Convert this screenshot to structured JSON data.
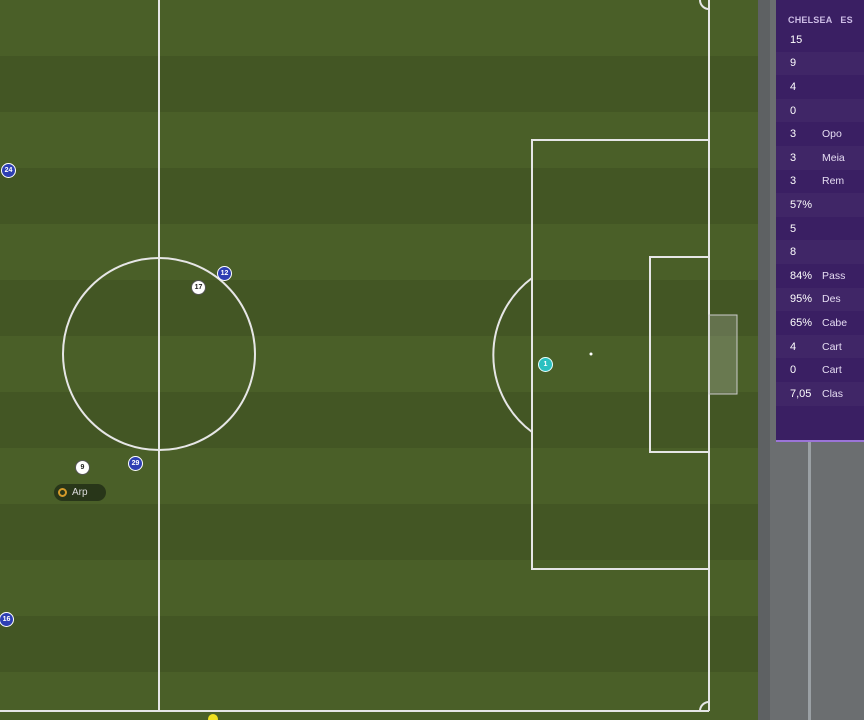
{
  "pitch": {
    "players": [
      {
        "number": "24",
        "team": "blue"
      },
      {
        "number": "12",
        "team": "blue"
      },
      {
        "number": "17",
        "team": "white"
      },
      {
        "number": "9",
        "team": "white"
      },
      {
        "number": "29",
        "team": "blue"
      },
      {
        "number": "16",
        "team": "blue"
      },
      {
        "number": "1",
        "team": "cyan"
      }
    ],
    "ball_carrier_tag": "Arp"
  },
  "stats_panel": {
    "team_home": "CHELSEA",
    "team_away": "ES",
    "rows": [
      {
        "value": "15",
        "label": ""
      },
      {
        "value": "9",
        "label": ""
      },
      {
        "value": "4",
        "label": ""
      },
      {
        "value": "0",
        "label": ""
      },
      {
        "value": "3",
        "label": "Opo"
      },
      {
        "value": "3",
        "label": "Meia"
      },
      {
        "value": "3",
        "label": "Rem"
      },
      {
        "value": "57%",
        "label": ""
      },
      {
        "value": "5",
        "label": ""
      },
      {
        "value": "8",
        "label": ""
      },
      {
        "value": "84%",
        "label": "Pass"
      },
      {
        "value": "95%",
        "label": "Des"
      },
      {
        "value": "65%",
        "label": "Cabe"
      },
      {
        "value": "4",
        "label": "Cart"
      },
      {
        "value": "0",
        "label": "Cart"
      },
      {
        "value": "7,05",
        "label": "Clas"
      }
    ]
  },
  "colors": {
    "pitch": "#4a5f28",
    "panel": "#3a1f63",
    "home_marker": "#2e3fb3",
    "keeper_marker": "#2bc0c0"
  }
}
